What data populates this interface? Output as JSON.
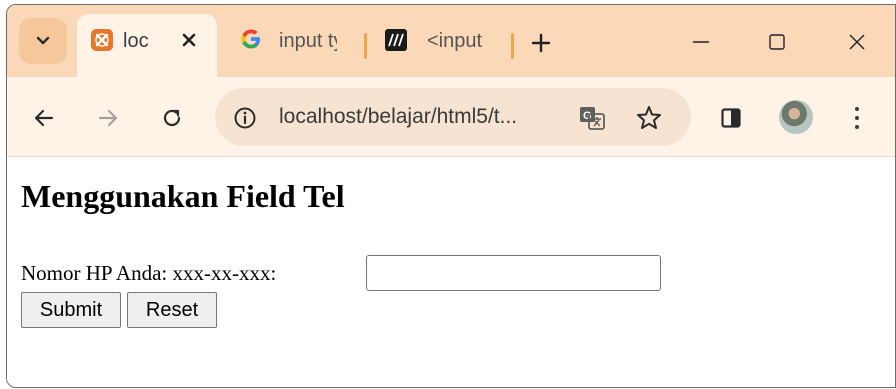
{
  "browser": {
    "tabs": [
      {
        "label": "loc",
        "favicon": "xampp-icon",
        "active": true
      },
      {
        "label": "input ty",
        "favicon": "google-icon",
        "active": false
      },
      {
        "label": "<input",
        "favicon": "mdn-icon",
        "active": false
      }
    ],
    "address": "localhost/belajar/html5/t...",
    "colors": {
      "tabstrip": "#fbd9b8",
      "toolbar": "#fff3e8",
      "omnibox": "#f7e3d1",
      "separator": "#f0a64b"
    }
  },
  "page": {
    "title": "Menggunakan Field Tel",
    "form": {
      "label": "Nomor HP Anda: xxx-xx-xxx:",
      "phone_value": "",
      "submit_label": "Submit",
      "reset_label": "Reset"
    }
  }
}
